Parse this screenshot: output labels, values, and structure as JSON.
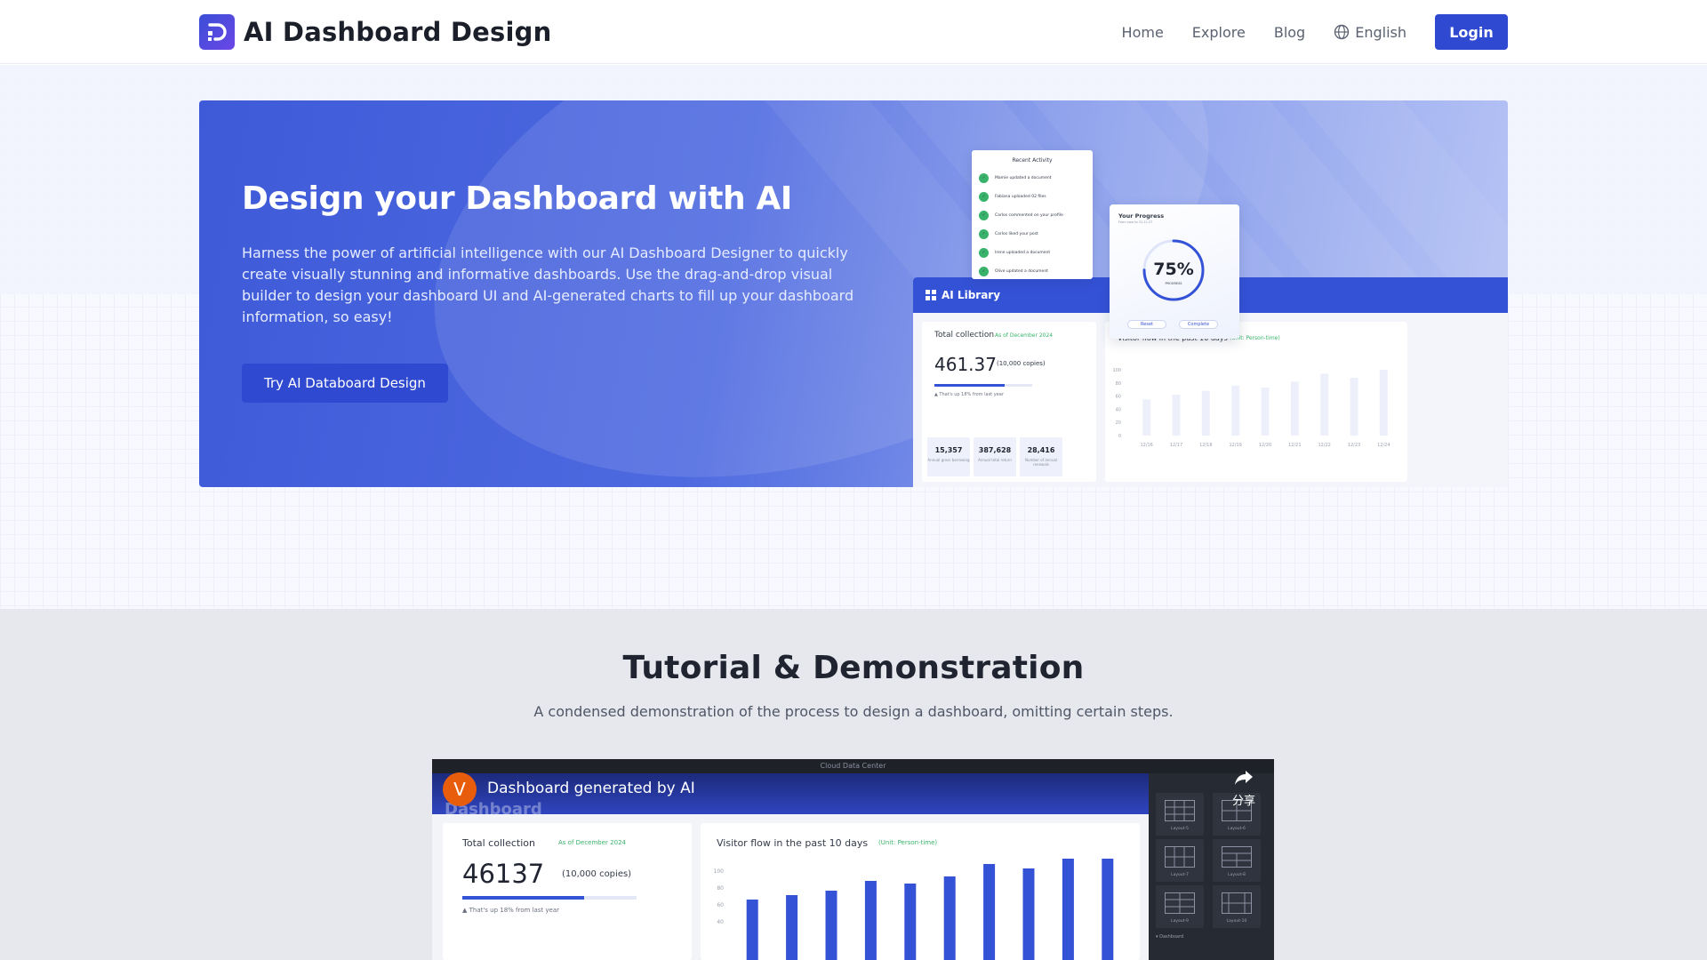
{
  "header": {
    "brand": "AI Dashboard Design",
    "nav": {
      "home": "Home",
      "explore": "Explore",
      "blog": "Blog",
      "language": "English",
      "login": "Login"
    }
  },
  "hero": {
    "title": "Design your Dashboard with AI",
    "description": "Harness the power of artificial intelligence with our AI Dashboard Designer to quickly create visually stunning and informative dashboards. Use the drag-and-drop visual builder to design your dashboard UI and AI-generated charts to fill up your dashboard information, so easy!",
    "cta": "Try AI Databoard Design"
  },
  "mockup": {
    "library_title": "AI Library",
    "total_collection": {
      "title": "Total collection",
      "date": "As of December 2024",
      "value": "461.37",
      "unit": "(10,000 copies)",
      "progress": 0.72,
      "note": "▲ That's up 18% from last year",
      "stats": [
        {
          "value": "15,357",
          "label": "Annual gross borrowing"
        },
        {
          "value": "387,628",
          "label": "Annual total return"
        },
        {
          "value": "28,416",
          "label": "Number of annual renewals"
        }
      ]
    },
    "visitor_flow": {
      "title": "Visitor flow in the past 10 days",
      "unit": "(Unit: Person-time)",
      "y_ticks": [
        "100",
        "80",
        "60",
        "40",
        "20",
        "0"
      ],
      "categories": [
        "12/16",
        "12/17",
        "12/18",
        "12/19",
        "12/20",
        "12/21",
        "12/22",
        "12/23",
        "12/24"
      ],
      "values": [
        55,
        62,
        68,
        76,
        73,
        82,
        94,
        88,
        100
      ],
      "bar_color": "#edf0fb"
    },
    "recent_activity": {
      "title": "Recent Activity",
      "items": [
        "Mamie updated a document",
        "Fabiana uploaded 02 files",
        "Carlos commented on your profile",
        "Carlos liked your post",
        "Irene uploaded a document",
        "Olive updated a document"
      ]
    },
    "your_progress": {
      "title": "Your Progress",
      "subtitle": "From now to 31.12.27",
      "value": "75%",
      "percent": 75,
      "label": "PROGRESS",
      "reset": "Reset",
      "complete": "Complete"
    }
  },
  "tutorial": {
    "title": "Tutorial & Demonstration",
    "subtitle": "A condensed demonstration of the process to design a dashboard, omitting certain steps."
  },
  "video": {
    "top_caption": "Cloud Data Center",
    "ghost_text": "Dashboard",
    "avatar_letter": "V",
    "title": "Dashboard generated by AI",
    "share_label": "分享",
    "layouts": [
      "Layout-5",
      "Layout-6",
      "Layout-7",
      "Layout-8",
      "Layout-9",
      "Layout-10"
    ],
    "sidebar_section": "▾ Dashboard",
    "total_collection": {
      "title": "Total collection",
      "date": "As of December 2024",
      "value": "46137",
      "unit": "(10,000 copies)",
      "progress": 0.7,
      "note": "▲ That's up 18% from last year"
    },
    "visitor_flow": {
      "title": "Visitor flow in the past 10 days",
      "unit": "(Unit: Person-time)",
      "y_ticks": [
        "100",
        "80",
        "60",
        "40"
      ],
      "values": [
        52,
        57,
        62,
        73,
        70,
        78,
        92,
        87,
        98,
        98
      ],
      "bar_color": "#3452d6"
    }
  },
  "colors": {
    "primary": "#2f49d1",
    "hero_start": "#3f5ad8",
    "hero_end": "#b9c6f5",
    "success": "#39b36b",
    "section_bg": "#e6e8ee"
  }
}
